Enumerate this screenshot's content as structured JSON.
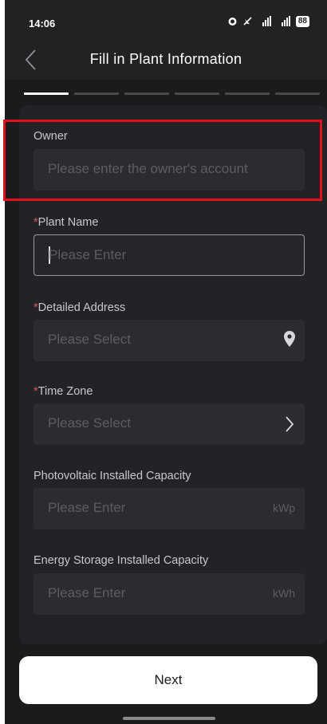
{
  "status_bar": {
    "time": "14:06",
    "battery": "88",
    "icons": [
      "alarm-icon",
      "dnd-icon",
      "signal-icon",
      "signal-icon"
    ]
  },
  "header": {
    "title": "Fill in Plant Information"
  },
  "progress": {
    "total_steps": 6,
    "current_step": 1
  },
  "form": {
    "owner": {
      "label": "Owner",
      "placeholder": "Please enter the owner's account"
    },
    "plant_name": {
      "required_mark": "*",
      "label": "Plant Name",
      "placeholder": "Please Enter"
    },
    "detailed_address": {
      "required_mark": "*",
      "label": "Detailed Address",
      "placeholder": "Please Select"
    },
    "time_zone": {
      "required_mark": "*",
      "label": "Time Zone",
      "placeholder": "Please Select"
    },
    "pv_capacity": {
      "label": "Photovoltaic Installed Capacity",
      "placeholder": "Please Enter",
      "unit": "kWp"
    },
    "storage_capacity": {
      "label": "Energy Storage Installed Capacity",
      "placeholder": "Please Enter",
      "unit": "kWh"
    }
  },
  "actions": {
    "next_label": "Next"
  },
  "colors": {
    "background": "#1b1b1e",
    "card": "#232327",
    "field": "#2c2c30",
    "required": "#e0565a",
    "highlight": "#e4101a"
  }
}
